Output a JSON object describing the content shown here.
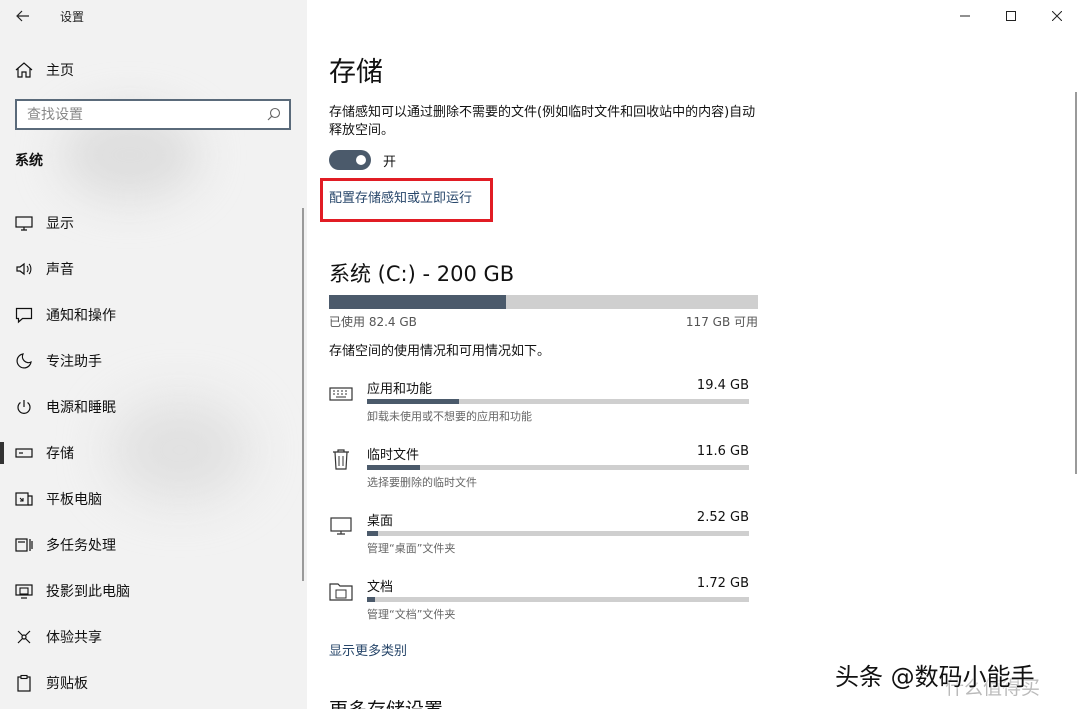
{
  "app": {
    "title": "设置"
  },
  "sidebar": {
    "home_label": "主页",
    "search_placeholder": "查找设置",
    "section_title": "系统",
    "items": [
      {
        "label": "显示",
        "icon": "monitor-icon"
      },
      {
        "label": "声音",
        "icon": "speaker-icon"
      },
      {
        "label": "通知和操作",
        "icon": "message-icon"
      },
      {
        "label": "专注助手",
        "icon": "moon-icon"
      },
      {
        "label": "电源和睡眠",
        "icon": "power-icon"
      },
      {
        "label": "存储",
        "icon": "storage-icon",
        "active": true
      },
      {
        "label": "平板电脑",
        "icon": "tablet-icon"
      },
      {
        "label": "多任务处理",
        "icon": "multitask-icon"
      },
      {
        "label": "投影到此电脑",
        "icon": "project-icon"
      },
      {
        "label": "体验共享",
        "icon": "share-icon"
      },
      {
        "label": "剪贴板",
        "icon": "clipboard-icon"
      }
    ]
  },
  "main": {
    "title": "存储",
    "description": "存储感知可以通过删除不需要的文件(例如临时文件和回收站中的内容)自动释放空间。",
    "toggle_label": "开",
    "toggle_on": true,
    "configure_link": "配置存储感知或立即运行",
    "drive": {
      "title": "系统 (C:) - 200 GB",
      "used_label": "已使用 82.4 GB",
      "free_label": "117 GB 可用",
      "used_fraction": 0.412
    },
    "usage_description": "存储空间的使用情况和可用情况如下。",
    "categories": [
      {
        "name": "应用和功能",
        "size": "19.4 GB",
        "sub": "卸载未使用或不想要的应用和功能",
        "fraction": 0.24,
        "icon": "keyboard-icon"
      },
      {
        "name": "临时文件",
        "size": "11.6 GB",
        "sub": "选择要删除的临时文件",
        "fraction": 0.14,
        "icon": "trash-icon"
      },
      {
        "name": "桌面",
        "size": "2.52 GB",
        "sub": "管理“桌面”文件夹",
        "fraction": 0.03,
        "icon": "desktop-icon"
      },
      {
        "name": "文档",
        "size": "1.72 GB",
        "sub": "管理“文档”文件夹",
        "fraction": 0.02,
        "icon": "documents-folder-icon"
      }
    ],
    "more_categories_link": "显示更多类别",
    "more_settings_heading": "更多存储设置"
  },
  "watermark": {
    "text": "头条 @数码小能手",
    "faint": "什么值得买"
  },
  "colors": {
    "accent": "#4b5a6b",
    "link": "#27466a",
    "highlight": "#e11c24"
  }
}
